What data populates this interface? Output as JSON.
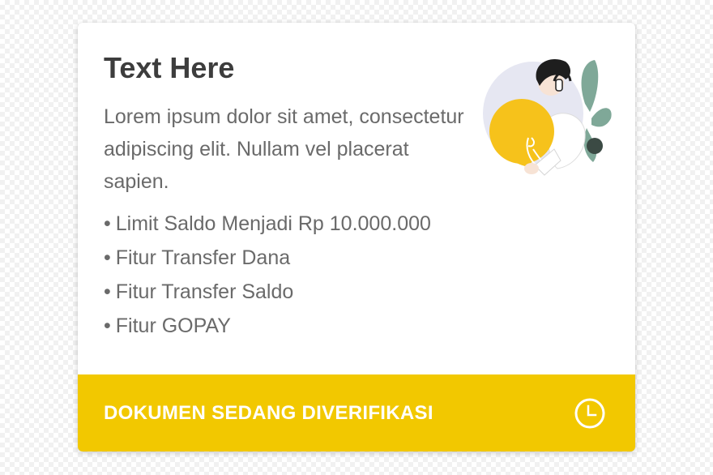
{
  "card": {
    "title": "Text Here",
    "description": "Lorem ipsum dolor sit amet, consectetur adipiscing elit. Nullam vel placerat sapien.",
    "bullet": "•",
    "features": [
      "Limit Saldo Menjadi Rp 10.000.000",
      "Fitur Transfer Dana",
      "Fitur Transfer Saldo",
      "Fitur GOPAY"
    ],
    "illustration_icon": "person-holding-lightbulb-illustration"
  },
  "status": {
    "label": "DOKUMEN SEDANG DIVERIFIKASI",
    "icon": "clock-icon"
  },
  "colors": {
    "accent": "#f2c800",
    "title_text": "#3d3d3d",
    "body_text": "#6a6a6a",
    "bulb": "#f6c21b",
    "leaf": "#7fa898"
  }
}
